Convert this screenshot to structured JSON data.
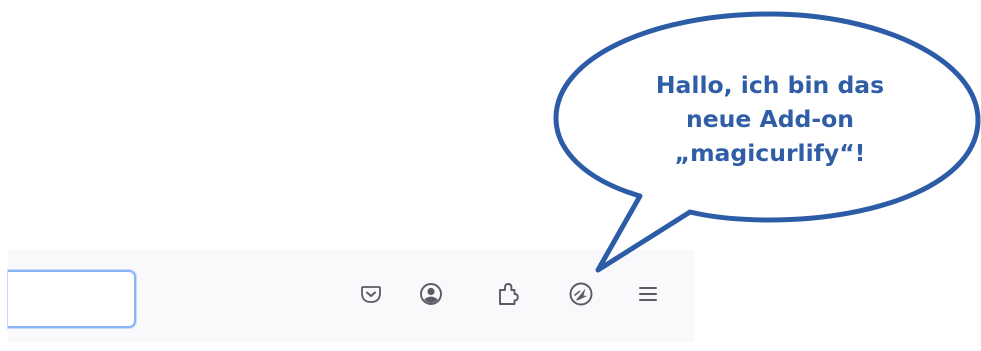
{
  "toolbar": {
    "address_bar": {
      "value": "",
      "placeholder": ""
    },
    "icons": [
      "pocket-icon",
      "account-icon",
      "extensions-icon",
      "magicurlify-icon",
      "menu-icon"
    ]
  },
  "speech_bubble": {
    "lines": [
      "Hallo, ich bin das",
      "neue Add-on",
      "„magicurlify“!"
    ],
    "text_color": "#2f5ea7",
    "border_color": "#2d5ca6"
  },
  "colors": {
    "toolbar_bg": "#f9f9fb",
    "icon_color": "#5b5b66",
    "focus_ring": "#8ab4f8"
  }
}
